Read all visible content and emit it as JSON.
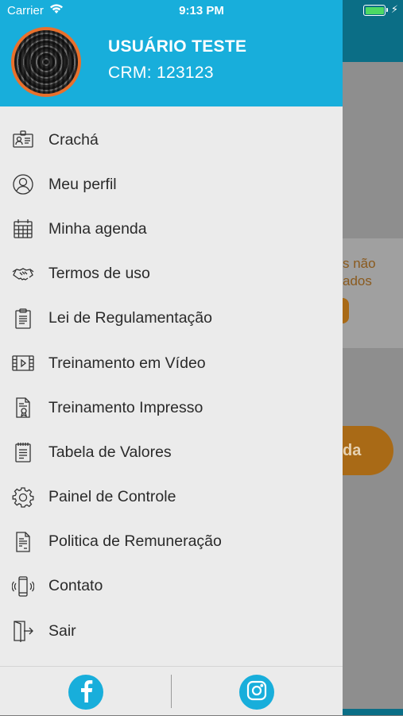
{
  "status_bar": {
    "carrier": "Carrier",
    "time": "9:13 PM"
  },
  "background": {
    "text_line1": "s não",
    "text_line2": "ados",
    "button_fragment": "da"
  },
  "user": {
    "name": "USUÁRIO TESTE",
    "crm": "CRM: 123123"
  },
  "menu": [
    {
      "label": "Crachá",
      "icon": "badge-icon"
    },
    {
      "label": "Meu perfil",
      "icon": "user-icon"
    },
    {
      "label": "Minha agenda",
      "icon": "calendar-icon"
    },
    {
      "label": "Termos de uso",
      "icon": "handshake-icon"
    },
    {
      "label": "Lei de Regulamentação",
      "icon": "clipboard-icon"
    },
    {
      "label": "Treinamento em Vídeo",
      "icon": "video-icon"
    },
    {
      "label": "Treinamento Impresso",
      "icon": "certificate-doc-icon"
    },
    {
      "label": "Tabela de Valores",
      "icon": "notepad-icon"
    },
    {
      "label": "Painel de Controle",
      "icon": "gear-icon"
    },
    {
      "label": "Politica de Remuneração",
      "icon": "document-icon"
    },
    {
      "label": "Contato",
      "icon": "phone-icon"
    },
    {
      "label": "Sair",
      "icon": "exit-door-icon"
    }
  ],
  "colors": {
    "header": "#18aedb",
    "avatar_ring": "#e8702c",
    "drawer_bg": "#ebebeb",
    "accent_orange": "#a96a16"
  },
  "social": [
    {
      "icon": "facebook-icon"
    },
    {
      "icon": "instagram-icon"
    }
  ]
}
